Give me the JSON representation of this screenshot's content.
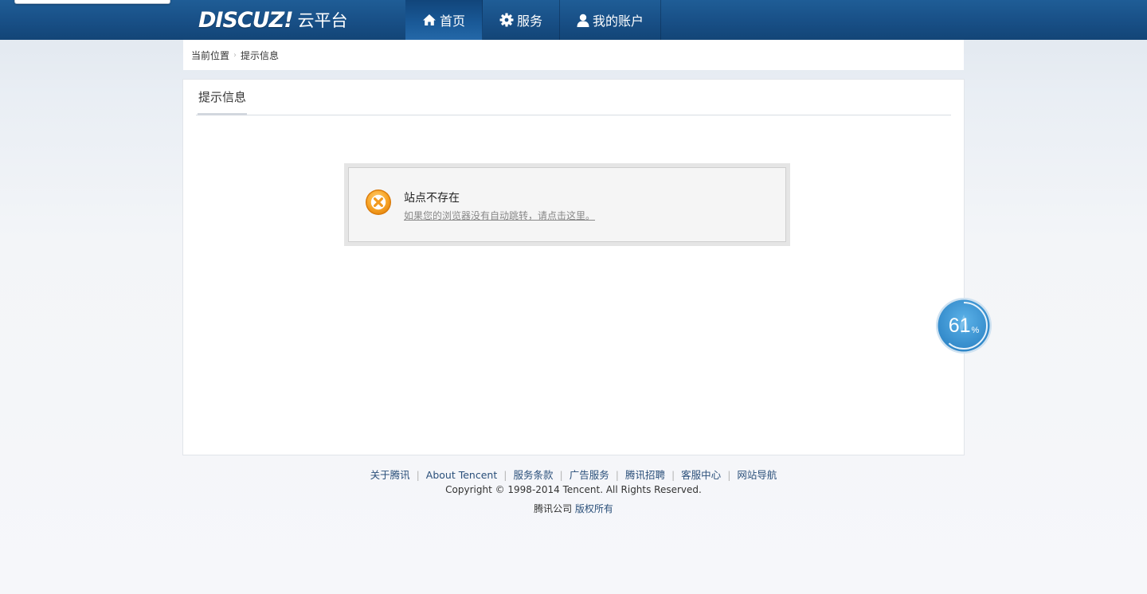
{
  "header": {
    "logo_main": "DISCUZ!",
    "logo_sub": "云平台",
    "nav": [
      {
        "label": "首页",
        "icon": "home-icon",
        "active": true
      },
      {
        "label": "服务",
        "icon": "gear-icon",
        "active": false
      },
      {
        "label": "我的账户",
        "icon": "user-icon",
        "active": false
      }
    ]
  },
  "breadcrumb": {
    "prefix": "当前位置",
    "separator": "›",
    "current": "提示信息"
  },
  "main": {
    "title": "提示信息",
    "alert": {
      "icon": "error-x-icon",
      "title": "站点不存在",
      "link": "如果您的浏览器没有自动跳转，请点击这里。"
    }
  },
  "progress_bubble": {
    "value": "61",
    "unit": "%",
    "percent": 61
  },
  "footer": {
    "links": [
      "关于腾讯",
      "About Tencent",
      "服务条款",
      "广告服务",
      "腾讯招聘",
      "客服中心",
      "网站导航"
    ],
    "separator": "|",
    "copyright": "Copyright © 1998-2014 Tencent. All Rights Reserved.",
    "company": "腾讯公司",
    "rights": "版权所有"
  },
  "colors": {
    "header_bg": "#184f86",
    "accent_link": "#2a4f7a",
    "error_icon": "#f7a52a",
    "bubble": "#3d98d6"
  }
}
